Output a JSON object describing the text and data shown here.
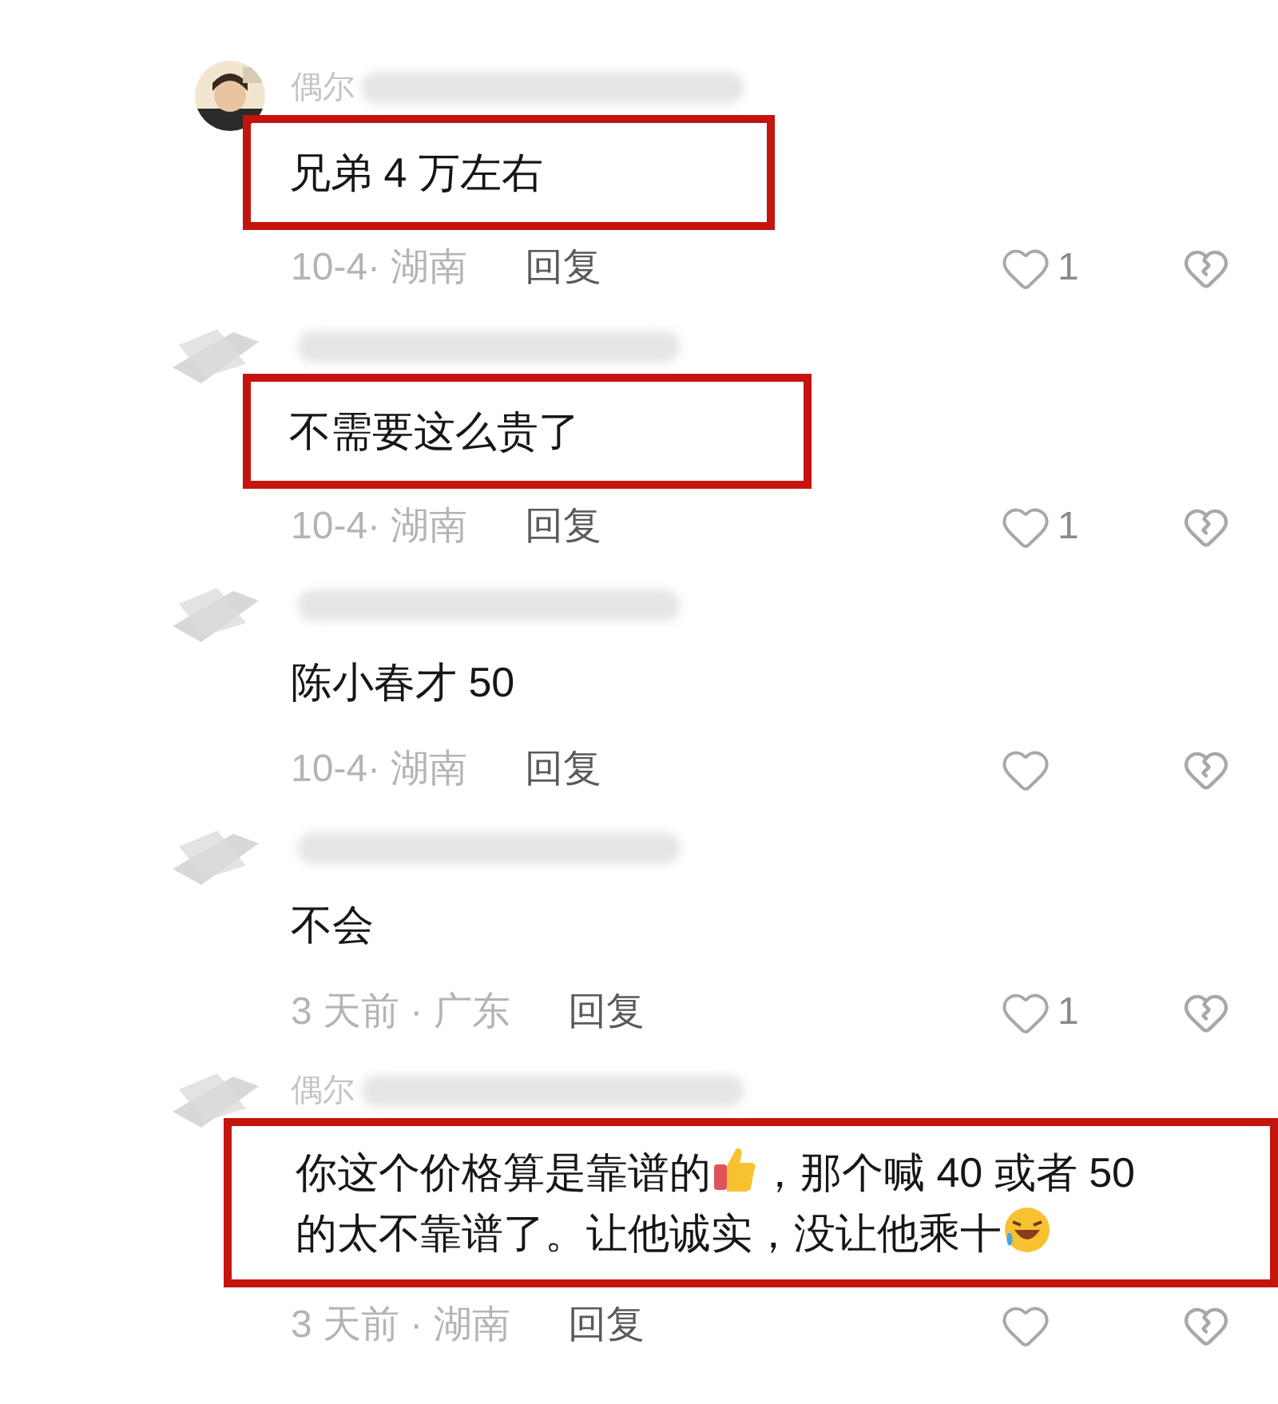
{
  "comments": [
    {
      "author": "偶尔",
      "kind": "photo",
      "highlighted": true,
      "body": [
        {
          "kind": "text",
          "text": "兄弟 4 万左右"
        }
      ],
      "meta": "10-4· 湖南",
      "reply": "回复",
      "likes": "1"
    },
    {
      "kind": "smudged",
      "highlighted": true,
      "body": [
        {
          "kind": "text",
          "text": "不需要这么贵了"
        }
      ],
      "meta": "10-4· 湖南",
      "reply": "回复",
      "likes": "1"
    },
    {
      "kind": "smudged",
      "highlighted": false,
      "body": [
        {
          "kind": "text",
          "text": "陈小春才 50"
        }
      ],
      "meta": "10-4· 湖南",
      "reply": "回复"
    },
    {
      "kind": "smudged",
      "highlighted": false,
      "body": [
        {
          "kind": "text",
          "text": "不会"
        }
      ],
      "meta": "3 天前 · 广东",
      "reply": "回复",
      "likes": "1"
    },
    {
      "author": "偶尔",
      "kind": "smudged",
      "highlighted": true,
      "body": [
        {
          "kind": "text",
          "text": "你这个价格算是靠谱的"
        },
        {
          "kind": "thumb"
        },
        {
          "kind": "text",
          "text": "，那个喊 40 或者 50 的太不靠谱了。让他诚实，没让他乘十"
        },
        {
          "kind": "laugh"
        }
      ],
      "meta": "3 天前 · 湖南",
      "reply": "回复"
    }
  ]
}
